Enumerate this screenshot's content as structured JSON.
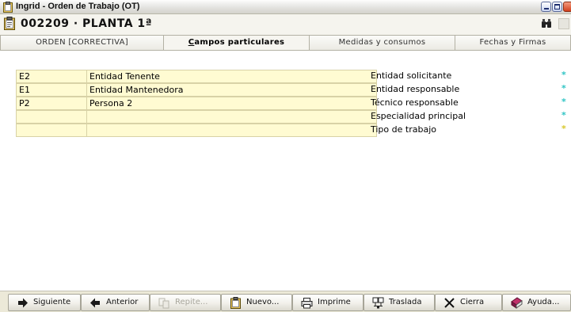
{
  "window": {
    "title": "Ingrid - Orden de Trabajo (OT)"
  },
  "header": {
    "title": "002209 · PLANTA 1ª"
  },
  "tabs": [
    {
      "label": "ORDEN [CORRECTIVA]"
    },
    {
      "label_underlined": "C",
      "label_rest": "ampos particulares"
    },
    {
      "label": "Medidas y consumos"
    },
    {
      "label": "Fechas y Firmas"
    }
  ],
  "rows": [
    {
      "code": "E2",
      "name": "Entidad Tenente",
      "label": "Entidad solicitante",
      "marker": "*"
    },
    {
      "code": "E1",
      "name": "Entidad Mantenedora",
      "label": "Entidad responsable",
      "marker": "*"
    },
    {
      "code": "P2",
      "name": "Persona 2",
      "label": "Técnico responsable",
      "marker": "*"
    },
    {
      "code": "",
      "name": "",
      "label": "Especialidad principal",
      "marker": "*"
    },
    {
      "code": "",
      "name": "",
      "label": "Tipo de trabajo",
      "marker": "*"
    }
  ],
  "toolbar": [
    {
      "label": "Siguiente",
      "icon": "arrow-right-icon"
    },
    {
      "label": "Anterior",
      "icon": "arrow-left-icon"
    },
    {
      "label": "Repite...",
      "icon": "repeat-icon",
      "disabled": true
    },
    {
      "label": "Nuevo...",
      "icon": "new-document-icon"
    },
    {
      "label": "Imprime",
      "icon": "printer-icon"
    },
    {
      "label": "Traslada",
      "icon": "transfer-icon"
    },
    {
      "label": "Cierra",
      "icon": "close-x-icon"
    },
    {
      "label": "Ayuda...",
      "icon": "help-book-icon"
    }
  ],
  "colors": {
    "field_bg": "#fffbd2",
    "marker_cyan": "#2ec4c4",
    "marker_yellow": "#d8c72a"
  }
}
